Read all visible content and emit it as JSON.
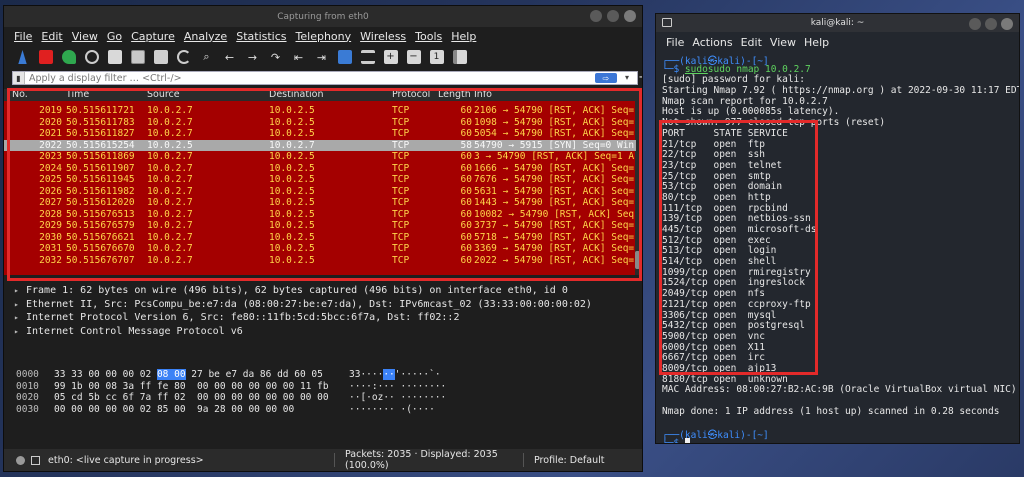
{
  "wireshark": {
    "title": "Capturing from eth0",
    "menus": [
      "File",
      "Edit",
      "View",
      "Go",
      "Capture",
      "Analyze",
      "Statistics",
      "Telephony",
      "Wireless",
      "Tools",
      "Help"
    ],
    "filter_placeholder": "Apply a display filter … <Ctrl-/>",
    "columns": {
      "no": "No.",
      "time": "Time",
      "source": "Source",
      "destination": "Destination",
      "protocol": "Protocol",
      "length": "Length",
      "info": "Info"
    },
    "packets": [
      {
        "no": "2019",
        "time": "50.515611721",
        "src": "10.0.2.7",
        "dst": "10.0.2.5",
        "proto": "TCP",
        "len": "60",
        "info": "2106 → 54790 [RST, ACK] Seq=",
        "selected": false
      },
      {
        "no": "2020",
        "time": "50.515611783",
        "src": "10.0.2.7",
        "dst": "10.0.2.5",
        "proto": "TCP",
        "len": "60",
        "info": "1098 → 54790 [RST, ACK] Seq=",
        "selected": false
      },
      {
        "no": "2021",
        "time": "50.515611827",
        "src": "10.0.2.7",
        "dst": "10.0.2.5",
        "proto": "TCP",
        "len": "60",
        "info": "5054 → 54790 [RST, ACK] Seq=",
        "selected": false
      },
      {
        "no": "2022",
        "time": "50.515615254",
        "src": "10.0.2.5",
        "dst": "10.0.2.7",
        "proto": "TCP",
        "len": "58",
        "info": "54790 → 5915 [SYN] Seq=0 Win",
        "selected": true
      },
      {
        "no": "2023",
        "time": "50.515611869",
        "src": "10.0.2.7",
        "dst": "10.0.2.5",
        "proto": "TCP",
        "len": "60",
        "info": "3 → 54790 [RST, ACK] Seq=1 A",
        "selected": false
      },
      {
        "no": "2024",
        "time": "50.515611907",
        "src": "10.0.2.7",
        "dst": "10.0.2.5",
        "proto": "TCP",
        "len": "60",
        "info": "1666 → 54790 [RST, ACK] Seq=",
        "selected": false
      },
      {
        "no": "2025",
        "time": "50.515611945",
        "src": "10.0.2.7",
        "dst": "10.0.2.5",
        "proto": "TCP",
        "len": "60",
        "info": "7676 → 54790 [RST, ACK] Seq=",
        "selected": false
      },
      {
        "no": "2026",
        "time": "50.515611982",
        "src": "10.0.2.7",
        "dst": "10.0.2.5",
        "proto": "TCP",
        "len": "60",
        "info": "5631 → 54790 [RST, ACK] Seq=",
        "selected": false
      },
      {
        "no": "2027",
        "time": "50.515612020",
        "src": "10.0.2.7",
        "dst": "10.0.2.5",
        "proto": "TCP",
        "len": "60",
        "info": "1443 → 54790 [RST, ACK] Seq=",
        "selected": false
      },
      {
        "no": "2028",
        "time": "50.515676513",
        "src": "10.0.2.7",
        "dst": "10.0.2.5",
        "proto": "TCP",
        "len": "60",
        "info": "10082 → 54790 [RST, ACK] Seq",
        "selected": false
      },
      {
        "no": "2029",
        "time": "50.515676579",
        "src": "10.0.2.7",
        "dst": "10.0.2.5",
        "proto": "TCP",
        "len": "60",
        "info": "3737 → 54790 [RST, ACK] Seq=",
        "selected": false
      },
      {
        "no": "2030",
        "time": "50.515676621",
        "src": "10.0.2.7",
        "dst": "10.0.2.5",
        "proto": "TCP",
        "len": "60",
        "info": "5718 → 54790 [RST, ACK] Seq=",
        "selected": false
      },
      {
        "no": "2031",
        "time": "50.515676670",
        "src": "10.0.2.7",
        "dst": "10.0.2.5",
        "proto": "TCP",
        "len": "60",
        "info": "3369 → 54790 [RST, ACK] Seq=",
        "selected": false
      },
      {
        "no": "2032",
        "time": "50.515676707",
        "src": "10.0.2.7",
        "dst": "10.0.2.5",
        "proto": "TCP",
        "len": "60",
        "info": "2022 → 54790 [RST, ACK] Seq=",
        "selected": false
      }
    ],
    "details": [
      "Frame 1: 62 bytes on wire (496 bits), 62 bytes captured (496 bits) on interface eth0, id 0",
      "Ethernet II, Src: PcsCompu_be:e7:da (08:00:27:be:e7:da), Dst: IPv6mcast_02 (33:33:00:00:00:02)",
      "Internet Protocol Version 6, Src: fe80::11fb:5cd:5bcc:6f7a, Dst: ff02::2",
      "Internet Control Message Protocol v6"
    ],
    "hex": [
      {
        "off": "0000",
        "hex_a": "33 33 00 00 00 02 ",
        "hex_hl": "08 00",
        "hex_b": " 27 be e7 da 86 dd 60 05",
        "asc_a": "33····",
        "asc_hl": "··",
        "asc_b": "'·····`·"
      },
      {
        "off": "0010",
        "hex_a": "99 1b 00 08 3a ff fe 80  00 00 00 00 00 00 11 fb",
        "hex_hl": "",
        "hex_b": "",
        "asc_a": "····:···",
        "asc_hl": "",
        "asc_b": " ········"
      },
      {
        "off": "0020",
        "hex_a": "05 cd 5b cc 6f 7a ff 02  00 00 00 00 00 00 00 00",
        "hex_hl": "",
        "hex_b": "",
        "asc_a": "··[·oz··",
        "asc_hl": "",
        "asc_b": " ········"
      },
      {
        "off": "0030",
        "hex_a": "00 00 00 00 00 02 85 00  9a 28 00 00 00 00",
        "hex_hl": "",
        "hex_b": "",
        "asc_a": "········",
        "asc_hl": "",
        "asc_b": " ·(····"
      }
    ],
    "status": {
      "capture": "eth0: <live capture in progress>",
      "packets": "Packets: 2035 · Displayed: 2035 (100.0%)",
      "profile": "Profile: Default"
    }
  },
  "terminal": {
    "title": "kali@kali: ~",
    "menus": [
      "File",
      "Actions",
      "Edit",
      "View",
      "Help"
    ],
    "prompt_user": "(kali㉿kali)-[~]",
    "command": "sudo nmap 10.0.2.7",
    "output_top": [
      "[sudo] password for kali:",
      "Starting Nmap 7.92 ( https://nmap.org ) at 2022-09-30 11:17 EDT",
      "Nmap scan report for 10.0.2.7",
      "Host is up (0.000085s latency).",
      "Not shown: 977 closed tcp ports (reset)",
      "PORT     STATE SERVICE"
    ],
    "ports": [
      "21/tcp   open  ftp",
      "22/tcp   open  ssh",
      "23/tcp   open  telnet",
      "25/tcp   open  smtp",
      "53/tcp   open  domain",
      "80/tcp   open  http",
      "111/tcp  open  rpcbind",
      "139/tcp  open  netbios-ssn",
      "445/tcp  open  microsoft-ds",
      "512/tcp  open  exec",
      "513/tcp  open  login",
      "514/tcp  open  shell",
      "1099/tcp open  rmiregistry",
      "1524/tcp open  ingreslock",
      "2049/tcp open  nfs",
      "2121/tcp open  ccproxy-ftp",
      "3306/tcp open  mysql",
      "5432/tcp open  postgresql",
      "5900/tcp open  vnc",
      "6000/tcp open  X11",
      "6667/tcp open  irc",
      "8009/tcp open  ajp13",
      "8180/tcp open  unknown"
    ],
    "mac": "MAC Address: 08:00:27:B2:AC:9B (Oracle VirtualBox virtual NIC)",
    "done": "Nmap done: 1 IP address (1 host up) scanned in 0.28 seconds",
    "prompt_user2": "(kali㉿kali)-[~]"
  }
}
